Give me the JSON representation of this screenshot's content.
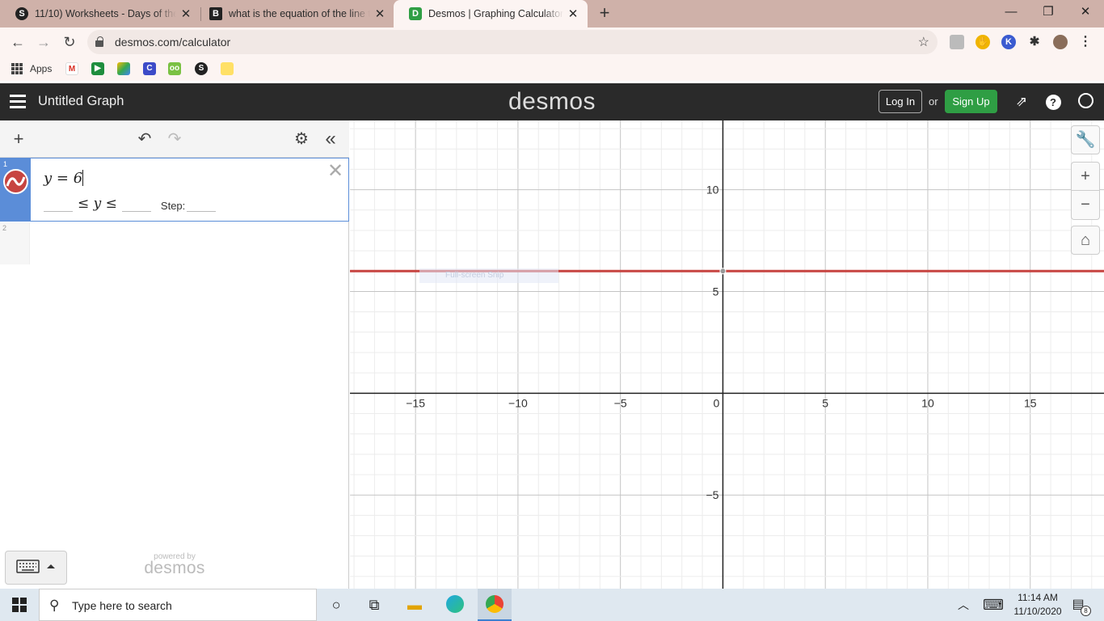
{
  "browser": {
    "tabs": [
      {
        "title": "11/10) Worksheets - Days of the",
        "favicon": "S",
        "favicon_color": "#222"
      },
      {
        "title": "what is the equation of the line th",
        "favicon": "B",
        "favicon_color": "#222"
      },
      {
        "title": "Desmos | Graphing Calculator",
        "favicon": "D",
        "favicon_color": "#2f9e44"
      }
    ],
    "url": "desmos.com/calculator",
    "bookmarks": {
      "apps_label": "Apps"
    }
  },
  "desmos": {
    "graph_title": "Untitled Graph",
    "logo": "desmos",
    "login_label": "Log In",
    "or_label": "or",
    "signup_label": "Sign Up",
    "accent_color": "#2f9e44",
    "expressions": [
      {
        "index": "1",
        "latex_display": "y = 6",
        "color": "#c74440",
        "restriction": {
          "var": "y",
          "step_label": "Step:"
        }
      },
      {
        "index": "2",
        "latex_display": ""
      }
    ],
    "powered_by": "powered by",
    "powered_logo": "desmos"
  },
  "chart_data": {
    "type": "line",
    "title": "",
    "xlim": [
      -18.2,
      18.6
    ],
    "ylim": [
      -9.6,
      13.4
    ],
    "x_ticks": [
      -15,
      -10,
      -5,
      0,
      5,
      10,
      15
    ],
    "y_ticks": [
      -5,
      5,
      10
    ],
    "grid": true,
    "series": [
      {
        "equation": "y = 6",
        "x": [
          -18.2,
          18.6
        ],
        "y": [
          6,
          6
        ],
        "color": "#c74440"
      }
    ]
  },
  "overlay": {
    "snip_label": "Full-screen Snip"
  },
  "taskbar": {
    "search_placeholder": "Type here to search",
    "time": "11:14 AM",
    "date": "11/10/2020",
    "notification_count": "8"
  }
}
